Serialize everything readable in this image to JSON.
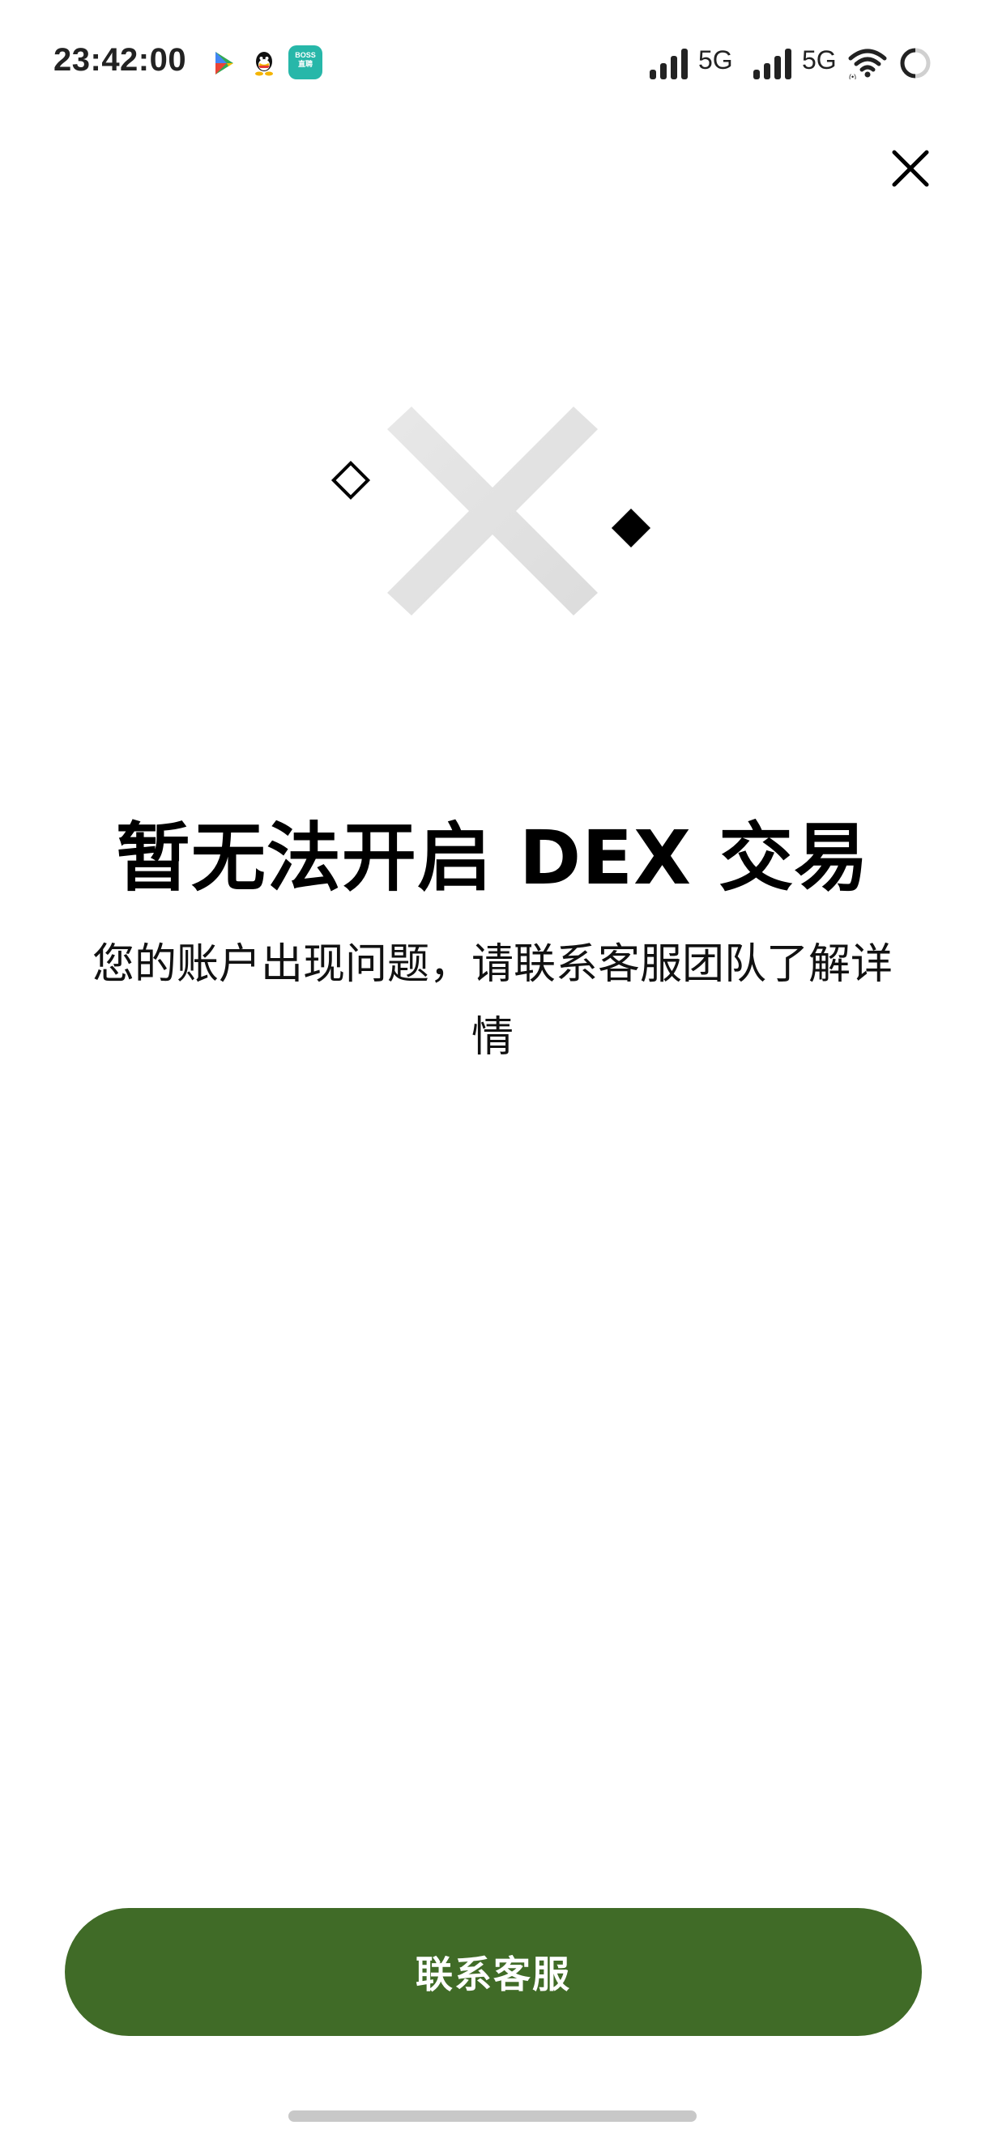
{
  "status_bar": {
    "time": "23:42:00",
    "boss_app_label": "BOSS\n直聘",
    "network_1": "5G",
    "network_2": "5G",
    "notification_icons": [
      "google-play-icon",
      "qq-icon",
      "boss-zhipin-icon"
    ],
    "status_icons": [
      "signal-icon",
      "signal-icon",
      "wifi-icon",
      "battery-icon"
    ]
  },
  "header": {
    "close_icon": "close-icon"
  },
  "illustration": {
    "icons": [
      "large-x-icon",
      "diamond-outline-icon",
      "diamond-filled-icon"
    ]
  },
  "main": {
    "title": "暂无法开启 DEX 交易",
    "description": "您的账户出现问题，请联系客服团队了解详情"
  },
  "footer": {
    "contact_button_label": "联系客服"
  },
  "colors": {
    "primary_button": "#406b27",
    "background": "#ffffff",
    "illustration_x": "#e4e4e4"
  }
}
